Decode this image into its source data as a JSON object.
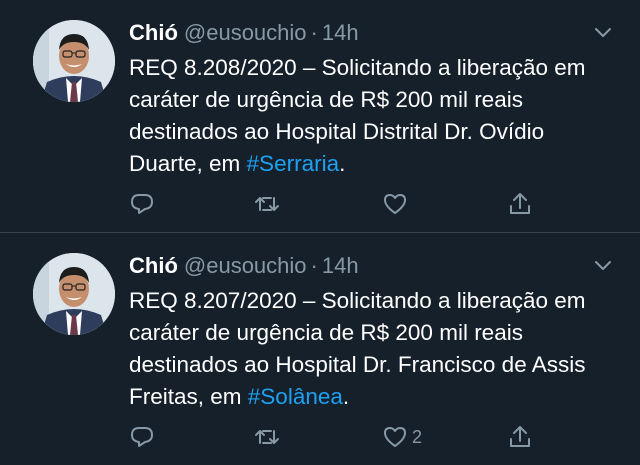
{
  "tweets": [
    {
      "name": "Chió",
      "handle": "@eusouchio",
      "separator": "·",
      "time": "14h",
      "text": "REQ 8.208/2020 – Solicitando a liberação em caráter de urgência de R$ 200 mil reais destinados ao Hospital Distrital Dr. Ovídio Duarte, em ",
      "hashtag": "#Serraria",
      "text_end": ".",
      "like_count": ""
    },
    {
      "name": "Chió",
      "handle": "@eusouchio",
      "separator": "·",
      "time": "14h",
      "text": "REQ 8.207/2020 – Solicitando a liberação em caráter de urgência de R$ 200 mil reais destinados ao Hospital Dr. Francisco de Assis Freitas, em ",
      "hashtag": "#Solânea",
      "text_end": ".",
      "like_count": "2"
    }
  ],
  "colors": {
    "background": "#15202b",
    "divider": "#38444d",
    "secondary_text": "#8899a6",
    "link": "#1da1f2"
  },
  "icons": [
    "avatar",
    "chevron-down-icon",
    "reply-icon",
    "retweet-icon",
    "like-icon",
    "share-icon"
  ]
}
